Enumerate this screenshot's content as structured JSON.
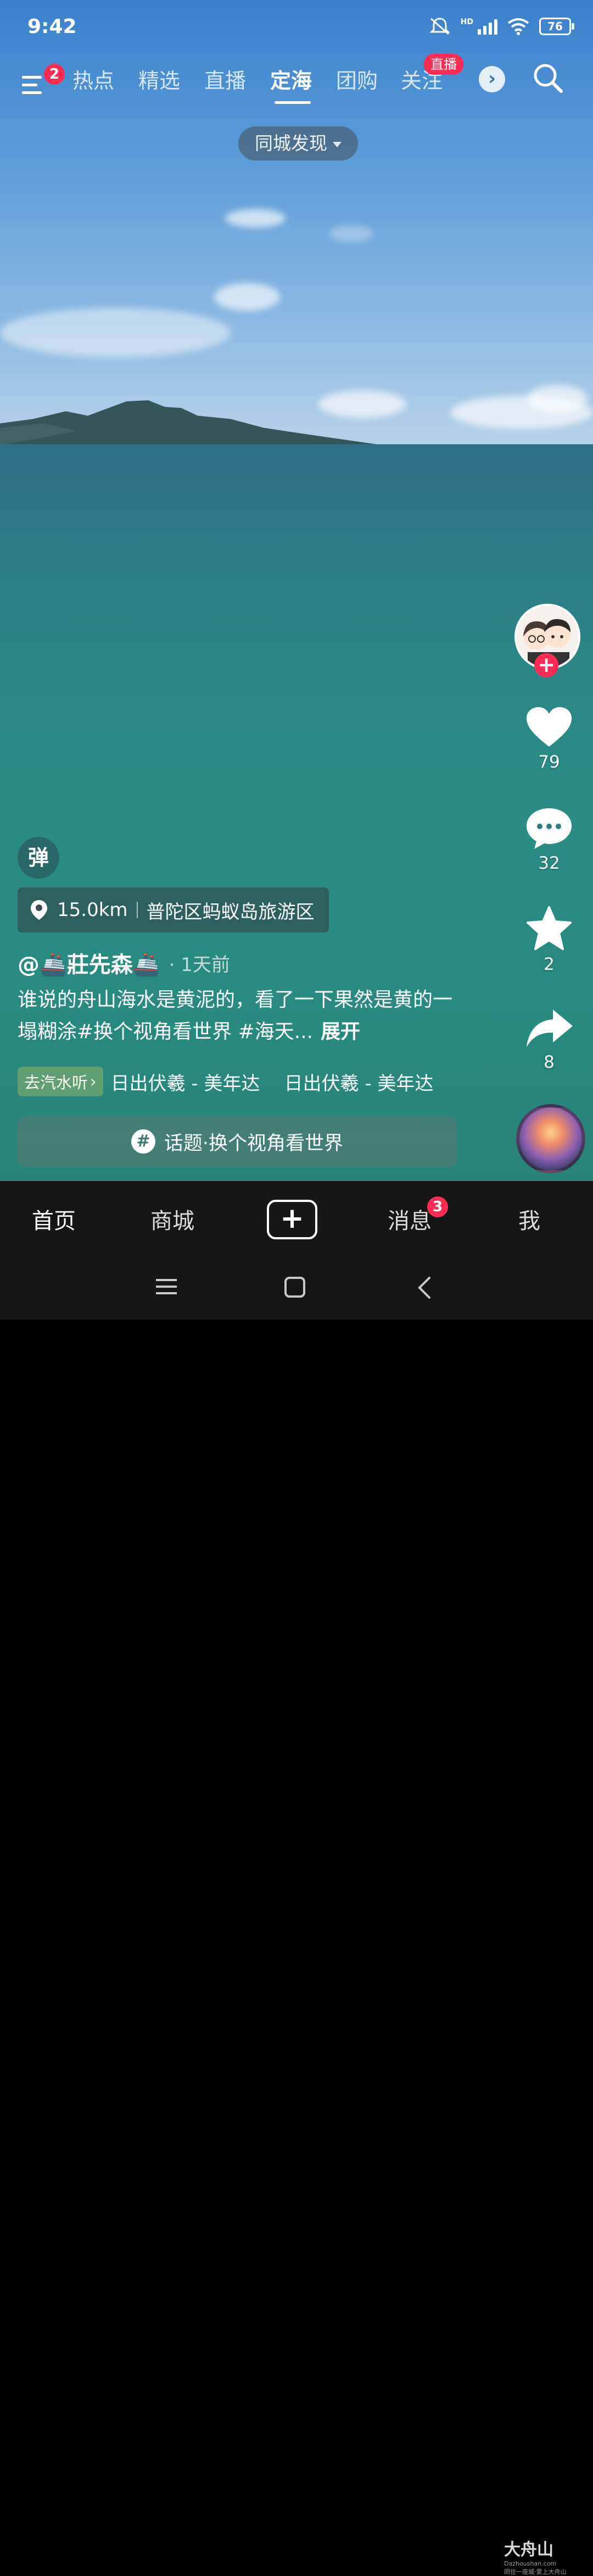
{
  "status_bar": {
    "time": "9:42",
    "network_badge": "HD",
    "battery": "76"
  },
  "top_nav": {
    "menu_badge": "2",
    "tabs": [
      {
        "label": "热点"
      },
      {
        "label": "精选"
      },
      {
        "label": "直播"
      },
      {
        "label": "定海",
        "active": true
      },
      {
        "label": "团购"
      },
      {
        "label": "关注"
      }
    ],
    "live_badge": "直播"
  },
  "city_discovery": {
    "label": "同城发现"
  },
  "actions": {
    "likes": "79",
    "comments": "32",
    "favorites": "2",
    "shares": "8"
  },
  "danmaku": {
    "label": "弹"
  },
  "location": {
    "distance": "15.0km",
    "place": "普陀区蚂蚁岛旅游区"
  },
  "post": {
    "author": "@🚢莊先森🚢",
    "time": "· 1天前",
    "caption": "谁说的舟山海水是黄泥的，看了一下果然是黄的一塌糊涂#换个视角看世界 #海天...",
    "expand": "展开"
  },
  "music": {
    "chip": "去汽水听",
    "title_1": "日出伏羲 - 美年达",
    "title_2": "日出伏羲 - 美年达"
  },
  "topic": {
    "label": "话题·换个视角看世界"
  },
  "bottom_nav": {
    "home": "首页",
    "mall": "商城",
    "messages": "消息",
    "messages_badge": "3",
    "me": "我"
  },
  "watermark": {
    "brand": "大舟山",
    "domain": "Dazhoushan.com",
    "slogan": "同住一座城·爱上大舟山"
  },
  "colors": {
    "accent": "#fe2c55",
    "nav_bg": "#161616"
  }
}
